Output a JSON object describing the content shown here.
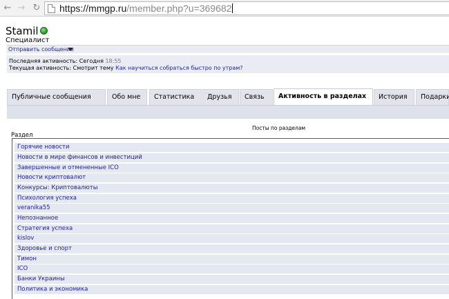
{
  "browser": {
    "url_protocol": "https://",
    "url_host": "mmgp.ru",
    "url_path": "/member.php?u=369682",
    "back_icon": "arrow-left",
    "forward_icon": "arrow-right",
    "reload_icon": "reload"
  },
  "profile": {
    "username": "Stamil",
    "status_color": "#2e9e2e",
    "user_title": "Специалист",
    "send_message": "Отправить сообщение"
  },
  "activity": {
    "last_label": "Последняя активность: Сегодня",
    "last_time": "18:55",
    "current_label": "Текущая активность: Смотрит тему",
    "current_link": "Как научиться собраться быстро по утрам?"
  },
  "tabs": [
    {
      "label": "Публичные сообщения"
    },
    {
      "label": "Обо мне"
    },
    {
      "label": "Статистика"
    },
    {
      "label": "Друзья"
    },
    {
      "label": "Связь"
    },
    {
      "label": "Активность в разделах"
    },
    {
      "label": "История"
    },
    {
      "label": "Подарки"
    }
  ],
  "main": {
    "posts_heading": "Посты по разделам",
    "column_header": "Раздел",
    "sections": [
      "Горячие новости",
      "Новости в мире финансов и инвестиций",
      "Завершенные и отмененные ICO",
      "Новости криптовалют",
      "Конкурсы: Криптовалюты",
      "Психология успеха",
      "veranika55",
      "Непознанное",
      "Стратегия успеха",
      "kislov",
      "Здоровье и спорт",
      "Тимон",
      "ICO",
      "Банки Украины",
      "Политика и экономика"
    ]
  }
}
